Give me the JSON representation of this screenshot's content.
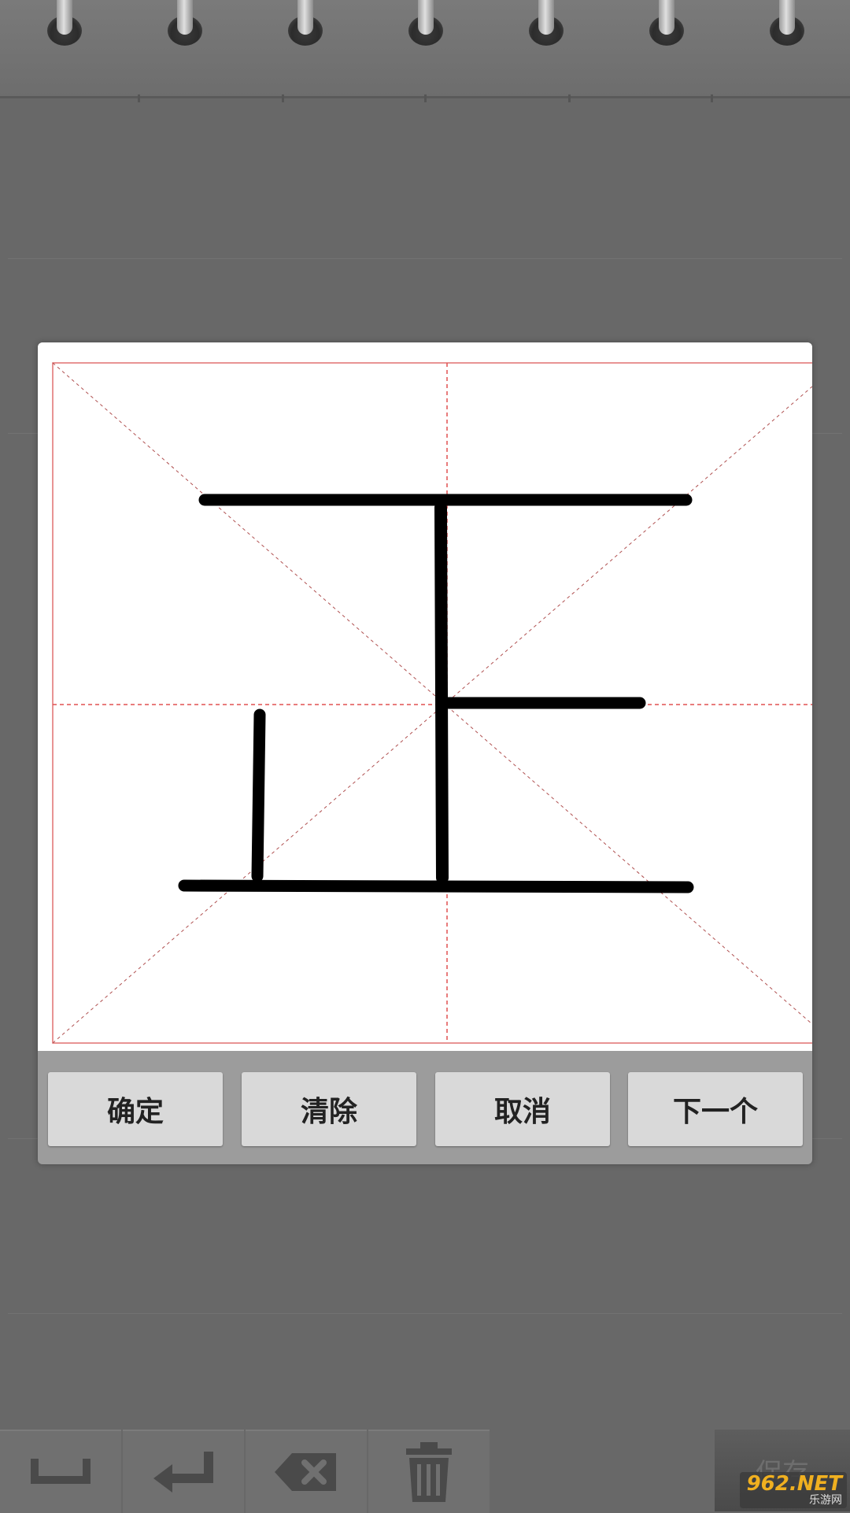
{
  "dialog": {
    "buttons": {
      "confirm": "确定",
      "clear": "清除",
      "cancel": "取消",
      "next": "下一个"
    }
  },
  "toolbar": {
    "tools": [
      "space-icon",
      "enter-icon",
      "backspace-icon",
      "trash-icon"
    ],
    "save_label": "保存"
  },
  "watermark": {
    "main": "962.NET",
    "sub": "乐游网"
  },
  "colors": {
    "grid_red": "#e05050",
    "ink": "#000000",
    "overlay": "#686868",
    "button_bg": "#d9d9d9"
  }
}
